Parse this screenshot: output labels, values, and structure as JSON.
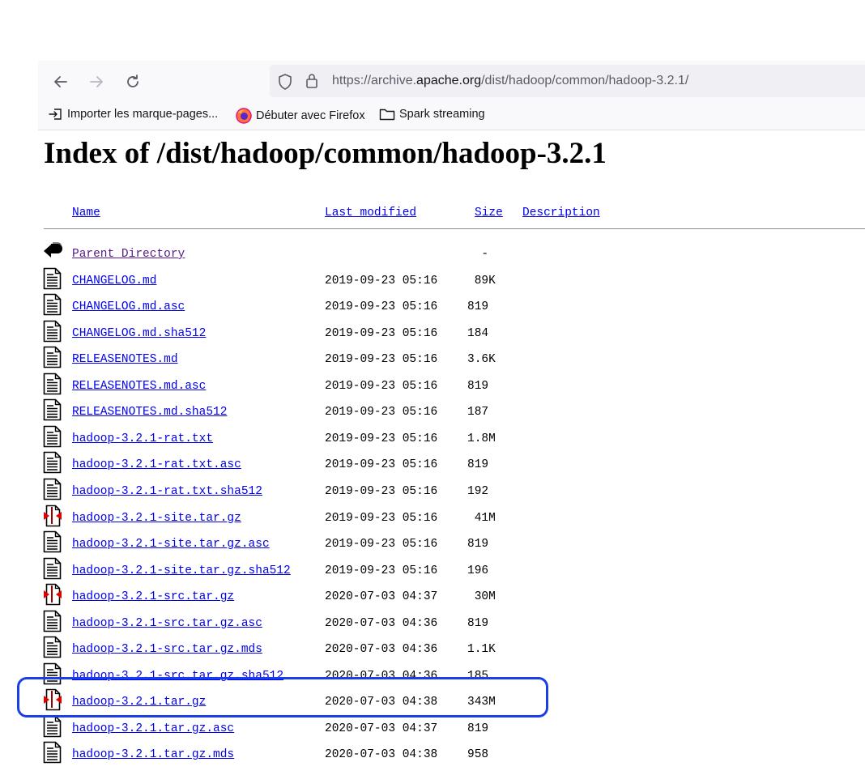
{
  "browser": {
    "url_prefix": "https://archive.",
    "url_domain": "apache.org",
    "url_path": "/dist/hadoop/common/hadoop-3.2.1/",
    "bookmarks": [
      {
        "label": "Importer les marque-pages...",
        "icon": "import-icon"
      },
      {
        "label": "Débuter avec Firefox",
        "icon": "firefox-icon"
      },
      {
        "label": "Spark streaming",
        "icon": "folder-icon"
      }
    ]
  },
  "page": {
    "title": "Index of /dist/hadoop/common/hadoop-3.2.1",
    "headers": {
      "name": "Name",
      "last_modified": "Last modified",
      "size": "Size",
      "description": "Description"
    },
    "rows": [
      {
        "name": "Parent Directory",
        "date": "",
        "size": "  -",
        "icon": "back-icon"
      },
      {
        "name": "CHANGELOG.md",
        "date": "2019-09-23 05:16",
        "size": " 89K",
        "icon": "text-file-icon"
      },
      {
        "name": "CHANGELOG.md.asc",
        "date": "2019-09-23 05:16",
        "size": "819",
        "icon": "text-file-icon"
      },
      {
        "name": "CHANGELOG.md.sha512",
        "date": "2019-09-23 05:16",
        "size": "184",
        "icon": "text-file-icon"
      },
      {
        "name": "RELEASENOTES.md",
        "date": "2019-09-23 05:16",
        "size": "3.6K",
        "icon": "text-file-icon"
      },
      {
        "name": "RELEASENOTES.md.asc",
        "date": "2019-09-23 05:16",
        "size": "819",
        "icon": "text-file-icon"
      },
      {
        "name": "RELEASENOTES.md.sha512",
        "date": "2019-09-23 05:16",
        "size": "187",
        "icon": "text-file-icon"
      },
      {
        "name": "hadoop-3.2.1-rat.txt",
        "date": "2019-09-23 05:16",
        "size": "1.8M",
        "icon": "text-file-icon"
      },
      {
        "name": "hadoop-3.2.1-rat.txt.asc",
        "date": "2019-09-23 05:16",
        "size": "819",
        "icon": "text-file-icon"
      },
      {
        "name": "hadoop-3.2.1-rat.txt.sha512",
        "date": "2019-09-23 05:16",
        "size": "192",
        "icon": "text-file-icon"
      },
      {
        "name": "hadoop-3.2.1-site.tar.gz",
        "date": "2019-09-23 05:16",
        "size": " 41M",
        "icon": "archive-file-icon"
      },
      {
        "name": "hadoop-3.2.1-site.tar.gz.asc",
        "date": "2019-09-23 05:16",
        "size": "819",
        "icon": "text-file-icon"
      },
      {
        "name": "hadoop-3.2.1-site.tar.gz.sha512",
        "date": "2019-09-23 05:16",
        "size": "196",
        "icon": "text-file-icon"
      },
      {
        "name": "hadoop-3.2.1-src.tar.gz",
        "date": "2020-07-03 04:37",
        "size": " 30M",
        "icon": "archive-file-icon"
      },
      {
        "name": "hadoop-3.2.1-src.tar.gz.asc",
        "date": "2020-07-03 04:36",
        "size": "819",
        "icon": "text-file-icon"
      },
      {
        "name": "hadoop-3.2.1-src.tar.gz.mds",
        "date": "2020-07-03 04:36",
        "size": "1.1K",
        "icon": "text-file-icon"
      },
      {
        "name": "hadoop-3.2.1-src.tar.gz.sha512",
        "date": "2020-07-03 04:36",
        "size": "185",
        "icon": "text-file-icon"
      },
      {
        "name": "hadoop-3.2.1.tar.gz",
        "date": "2020-07-03 04:38",
        "size": "343M",
        "icon": "archive-file-icon"
      },
      {
        "name": "hadoop-3.2.1.tar.gz.asc",
        "date": "2020-07-03 04:37",
        "size": "819",
        "icon": "text-file-icon"
      },
      {
        "name": "hadoop-3.2.1.tar.gz.mds",
        "date": "2020-07-03 04:38",
        "size": "958",
        "icon": "text-file-icon"
      }
    ],
    "highlighted_row": "hadoop-3.2.1.tar.gz",
    "highlight_color": "#1a3ee8"
  }
}
